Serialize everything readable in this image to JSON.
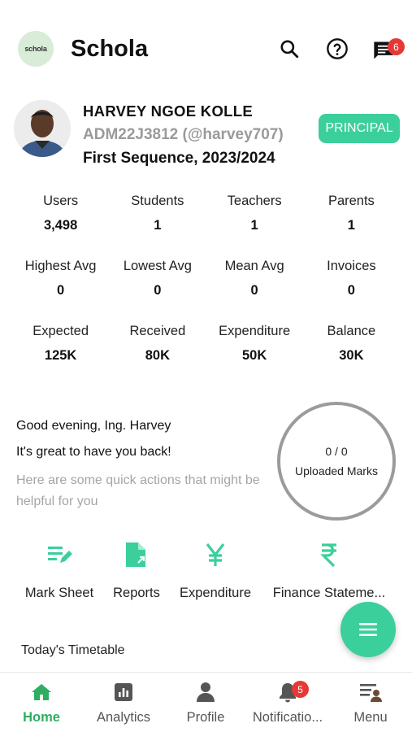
{
  "header": {
    "logo_text": "schola",
    "title": "Schola",
    "icons": [
      "search-icon",
      "help-icon",
      "messages-icon"
    ],
    "messages_badge": "6"
  },
  "profile": {
    "name": "HARVEY NGOE KOLLE",
    "id_handle": "ADM22J3812 (@harvey707)",
    "term": "First Sequence, 2023/2024",
    "role": "PRINCIPAL"
  },
  "stats": [
    [
      {
        "label": "Users",
        "value": "3,498"
      },
      {
        "label": "Students",
        "value": "1"
      },
      {
        "label": "Teachers",
        "value": "1"
      },
      {
        "label": "Parents",
        "value": "1"
      }
    ],
    [
      {
        "label": "Highest Avg",
        "value": "0"
      },
      {
        "label": "Lowest Avg",
        "value": "0"
      },
      {
        "label": "Mean Avg",
        "value": "0"
      },
      {
        "label": "Invoices",
        "value": "0"
      }
    ],
    [
      {
        "label": "Expected",
        "value": "125K"
      },
      {
        "label": "Received",
        "value": "80K"
      },
      {
        "label": "Expenditure",
        "value": "50K"
      },
      {
        "label": "Balance",
        "value": "30K"
      }
    ]
  ],
  "greeting": {
    "line1": "Good evening, Ing. Harvey",
    "line2": "It's great to have you back!",
    "line3": "Here are some quick actions that might be helpful for you"
  },
  "marks": {
    "count": "0 / 0",
    "label": "Uploaded Marks"
  },
  "actions": [
    {
      "label": "Mark Sheet",
      "icon": "mark-sheet-icon"
    },
    {
      "label": "Reports",
      "icon": "reports-icon"
    },
    {
      "label": "Expenditure",
      "icon": "yen-icon"
    },
    {
      "label": "Finance Stateme...",
      "icon": "rupee-icon"
    }
  ],
  "timetable_title": "Today's Timetable",
  "nav": [
    {
      "label": "Home",
      "icon": "home-icon",
      "active": true
    },
    {
      "label": "Analytics",
      "icon": "analytics-icon"
    },
    {
      "label": "Profile",
      "icon": "profile-icon"
    },
    {
      "label": "Notificatio...",
      "icon": "bell-icon",
      "badge": "5"
    },
    {
      "label": "Menu",
      "icon": "menu-icon"
    }
  ],
  "colors": {
    "accent": "#3bcf9b",
    "nav_active": "#2fae62",
    "badge": "#e53935"
  }
}
